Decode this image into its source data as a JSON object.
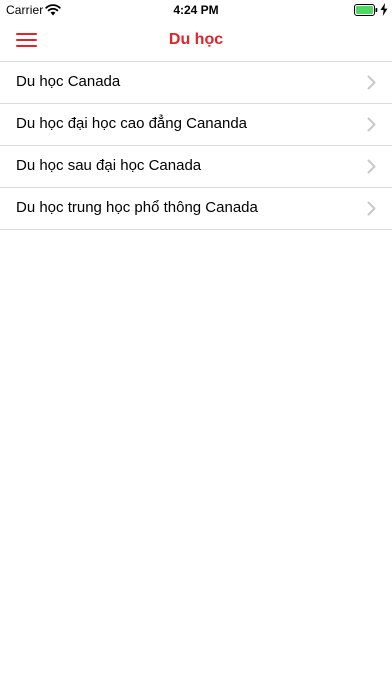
{
  "status_bar": {
    "carrier": "Carrier",
    "time": "4:24 PM",
    "icons": [
      "wifi-icon",
      "battery-icon",
      "charging-icon"
    ]
  },
  "nav": {
    "title": "Du học",
    "menu_icon": "hamburger-menu-icon"
  },
  "colors": {
    "accent": "#e0242c",
    "separator": "#dcdcdf",
    "chevron": "#c7c7cc",
    "battery_fill": "#4cd964"
  },
  "list": {
    "items": [
      {
        "label": "Du học Canada"
      },
      {
        "label": "Du học đại học cao đẳng Cananda"
      },
      {
        "label": "Du học sau đại học Canada"
      },
      {
        "label": "Du học trung học phổ thông Canada"
      }
    ]
  }
}
